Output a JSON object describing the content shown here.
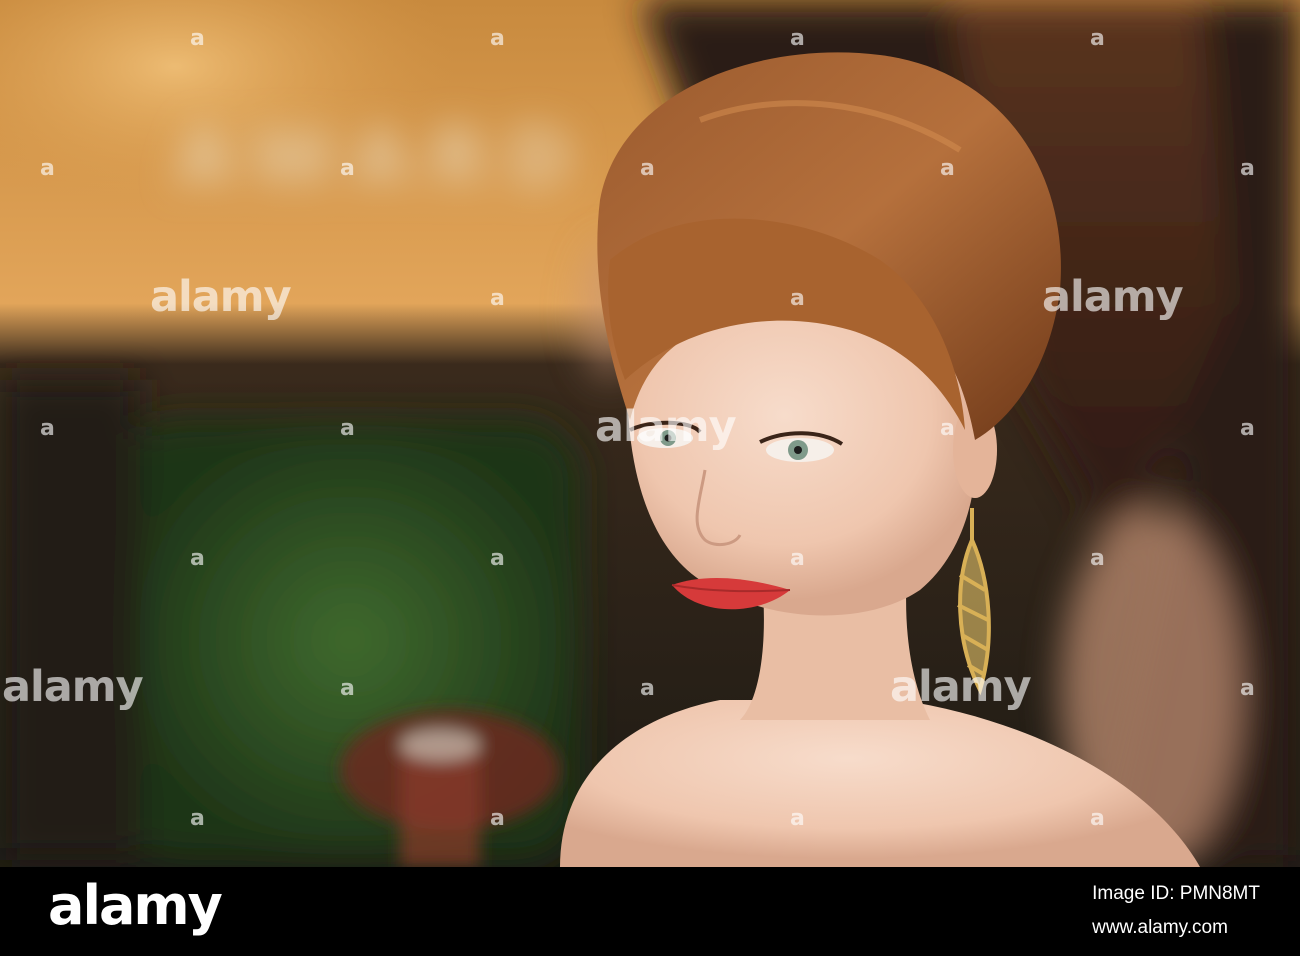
{
  "photo": {
    "subject": "portrait-photo",
    "background_sign_text": "AWARD",
    "colors": {
      "backdrop_gold": "#d99a4a",
      "hair_auburn": "#8a4a22",
      "skin": "#f0c7b0",
      "lips": "#d63a3a",
      "footer": "#000000"
    }
  },
  "watermark": {
    "word": "alamy",
    "mark": "a"
  },
  "footer": {
    "logo_text": "alamy",
    "image_id_label": "Image ID:",
    "image_id": "PMN8MT",
    "site_url": "www.alamy.com"
  }
}
